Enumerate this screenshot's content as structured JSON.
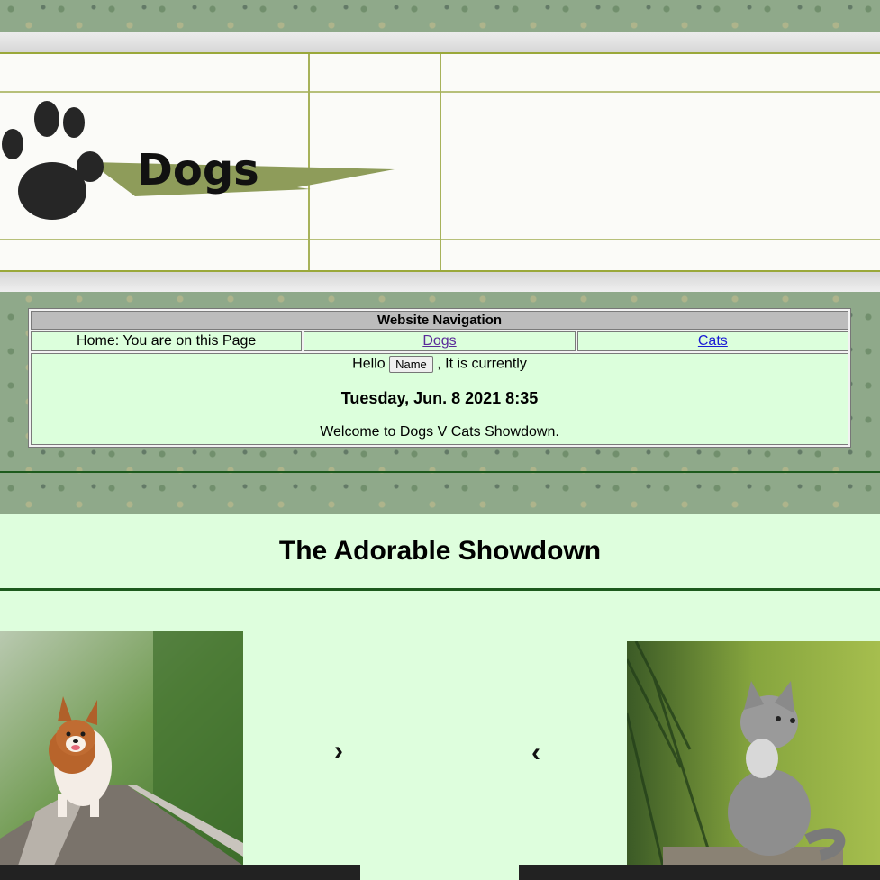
{
  "banner": {
    "logo_text": "Dogs"
  },
  "nav": {
    "heading": "Website Navigation",
    "home_text": "Home: You are on this Page",
    "dogs_link": "Dogs",
    "cats_link": "Cats",
    "hello_text": "Hello",
    "name_button": "Name",
    "currently_text": ", It is currently",
    "datetime": "Tuesday, Jun. 8 2021 8:35",
    "welcome": "Welcome to Dogs V Cats Showdown."
  },
  "showdown": {
    "title": "The Adorable Showdown",
    "next_arrow": "›",
    "prev_arrow": "‹"
  }
}
